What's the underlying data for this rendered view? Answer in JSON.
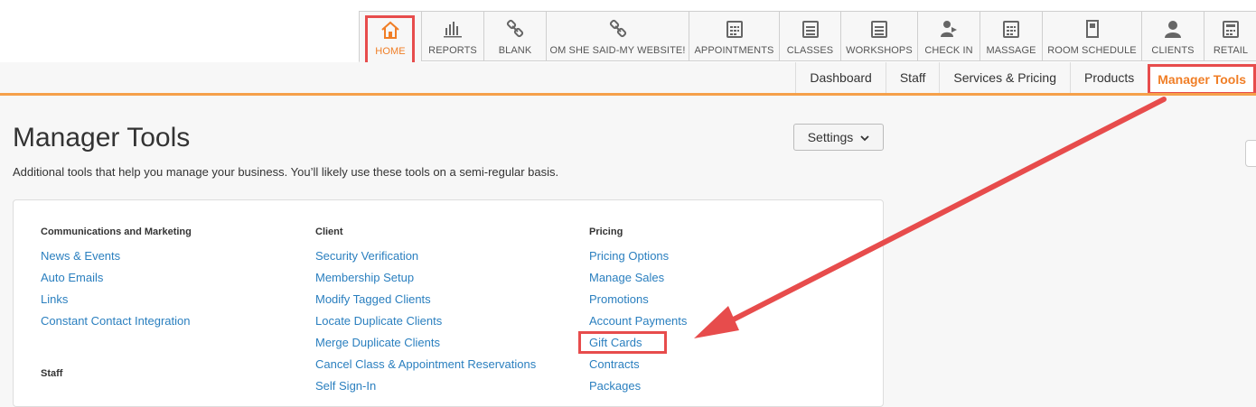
{
  "nav": {
    "tabs": [
      {
        "label": "HOME",
        "icon": "home-icon",
        "active": true
      },
      {
        "label": "REPORTS",
        "icon": "bar-chart-icon"
      },
      {
        "label": "BLANK",
        "icon": "link-icon"
      },
      {
        "label": "OM SHE SAID-MY WEBSITE!",
        "icon": "link-icon"
      },
      {
        "label": "APPOINTMENTS",
        "icon": "calendar-icon"
      },
      {
        "label": "CLASSES",
        "icon": "calendar-icon"
      },
      {
        "label": "WORKSHOPS",
        "icon": "calendar-icon"
      },
      {
        "label": "CHECK IN",
        "icon": "check-in-icon"
      },
      {
        "label": "MASSAGE",
        "icon": "calendar-icon"
      },
      {
        "label": "ROOM SCHEDULE",
        "icon": "door-icon"
      },
      {
        "label": "CLIENTS",
        "icon": "person-icon"
      },
      {
        "label": "RETAIL",
        "icon": "register-icon"
      }
    ]
  },
  "subnav": {
    "items": [
      "Dashboard",
      "Staff",
      "Services & Pricing",
      "Products",
      "Manager Tools"
    ]
  },
  "page": {
    "title": "Manager Tools",
    "description": "Additional tools that help you manage your business. You’ll likely use these tools on a semi-regular basis.",
    "settings_label": "Settings"
  },
  "columns": {
    "comm": {
      "heading": "Communications and Marketing",
      "links": [
        "News & Events",
        "Auto Emails",
        "Links",
        "Constant Contact Integration"
      ],
      "heading2": "Staff"
    },
    "client": {
      "heading": "Client",
      "links": [
        "Security Verification",
        "Membership Setup",
        "Modify Tagged Clients",
        "Locate Duplicate Clients",
        "Merge Duplicate Clients",
        "Cancel Class & Appointment Reservations",
        "Self Sign-In"
      ]
    },
    "pricing": {
      "heading": "Pricing",
      "links": [
        "Pricing Options",
        "Manage Sales",
        "Promotions",
        "Account Payments",
        "Gift Cards",
        "Contracts",
        "Packages"
      ]
    }
  },
  "colors": {
    "accent": "#f07e26",
    "link": "#2a7fbf",
    "highlight": "#e74c4c"
  }
}
